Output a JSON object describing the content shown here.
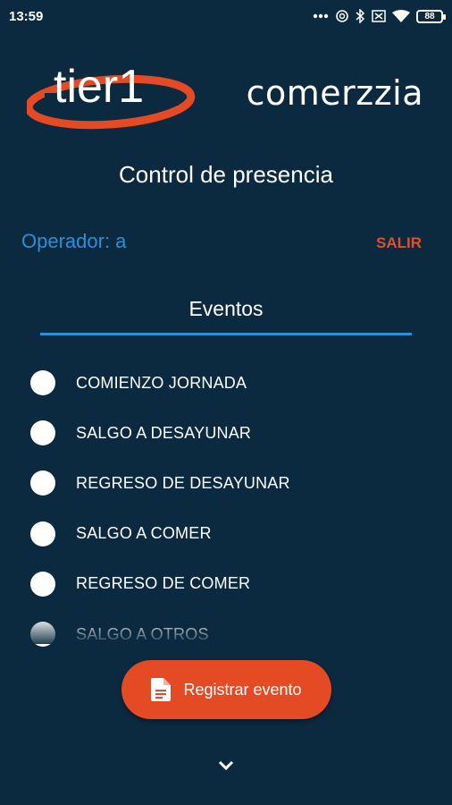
{
  "status_bar": {
    "time": "13:59",
    "battery": "88"
  },
  "brand": {
    "left_logo": "tier1",
    "right_logo": "comerzzia"
  },
  "page_title": "Control de presencia",
  "operator": {
    "label": "Operador: a",
    "exit": "SALIR"
  },
  "events": {
    "title": "Eventos",
    "items": [
      {
        "label": "COMIENZO JORNADA"
      },
      {
        "label": "SALGO A DESAYUNAR"
      },
      {
        "label": "REGRESO DE DESAYUNAR"
      },
      {
        "label": "SALGO A COMER"
      },
      {
        "label": "REGRESO DE COMER"
      },
      {
        "label": "SALGO A OTROS"
      }
    ]
  },
  "register_button": {
    "label": "Registrar evento"
  },
  "colors": {
    "background": "#0b2a40",
    "accent_blue": "#2e8fd6",
    "accent_orange": "#e44a24"
  },
  "icons": [
    "dots-icon",
    "sync-icon",
    "bluetooth-icon",
    "sim-icon",
    "wifi-icon",
    "battery-icon",
    "document-icon",
    "chevron-down-icon"
  ]
}
